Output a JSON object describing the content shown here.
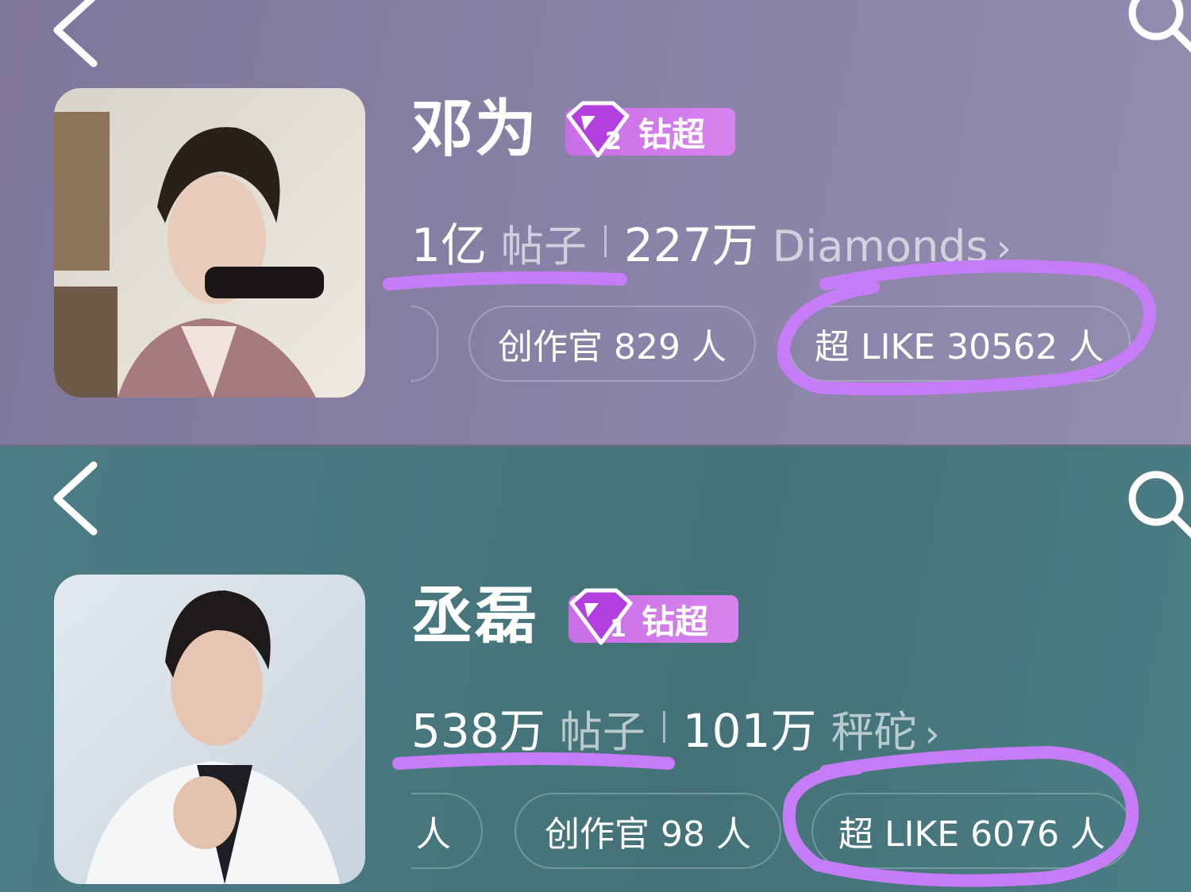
{
  "cards": [
    {
      "name": "邓为",
      "badge": {
        "level": "2",
        "label": "钻超"
      },
      "stats": [
        {
          "value": "1亿",
          "unit": "帖子"
        },
        {
          "value": "227万",
          "unit": "Diamonds"
        }
      ],
      "chips": [
        {
          "text": ""
        },
        {
          "text": "创作官 829 人"
        },
        {
          "text": "超 LIKE 30562 人"
        }
      ]
    },
    {
      "name": "丞磊",
      "badge": {
        "level": "1",
        "label": "钻超"
      },
      "stats": [
        {
          "value": "538万",
          "unit": "帖子"
        },
        {
          "value": "101万",
          "unit": "秤砣"
        }
      ],
      "chips": [
        {
          "text": "人"
        },
        {
          "text": "创作官 98 人"
        },
        {
          "text": "超 LIKE 6076 人"
        }
      ]
    }
  ],
  "colors": {
    "top_bg": "#867e a3",
    "bottom_bg": "#477780",
    "badge": "#cf78ea",
    "annotation": "#c77cf5"
  },
  "icons": [
    "back-icon",
    "search-icon",
    "diamond-gem-icon",
    "chevron-right-icon"
  ]
}
